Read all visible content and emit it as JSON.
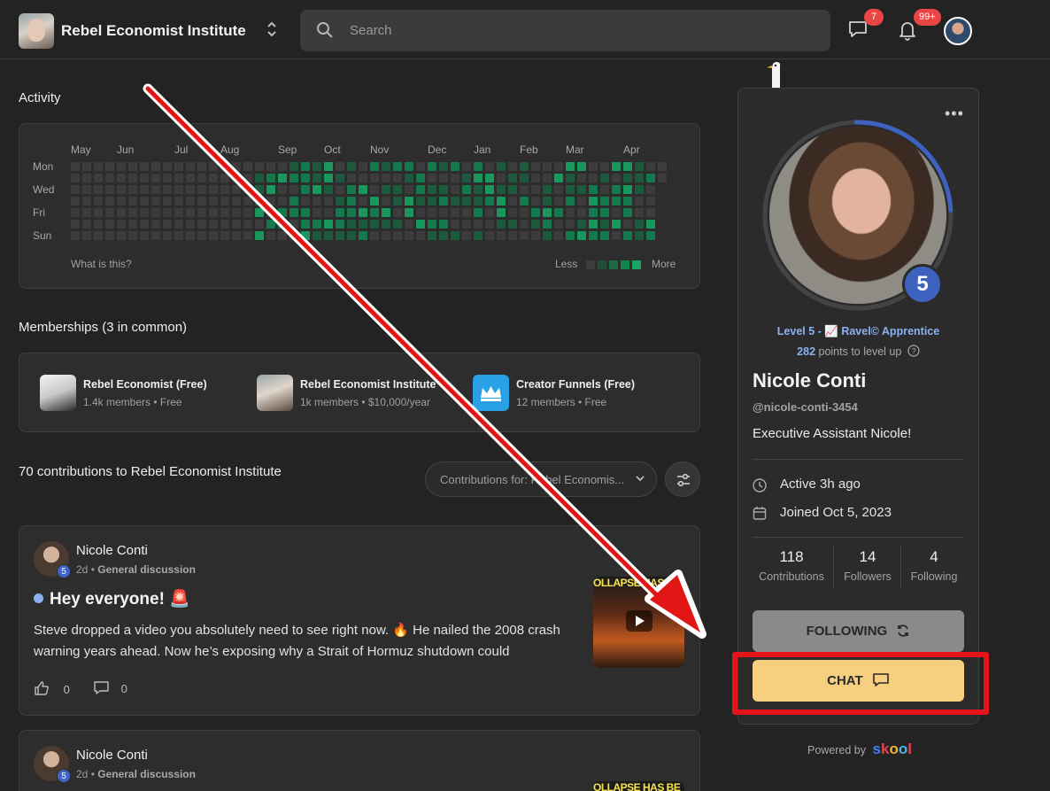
{
  "header": {
    "brand": "Rebel Economist Institute",
    "search_placeholder": "Search",
    "chat_badge": "7",
    "notif_badge": "99+"
  },
  "activity": {
    "title": "Activity",
    "months": [
      "May",
      "Jun",
      "Jul",
      "Aug",
      "Sep",
      "Oct",
      "Nov",
      "Dec",
      "Jan",
      "Feb",
      "Mar",
      "Apr"
    ],
    "days": [
      "Mon",
      "Wed",
      "Fri",
      "Sun"
    ],
    "what_is_this": "What is this?",
    "less": "Less",
    "more": "More"
  },
  "memberships": {
    "title": "Memberships (3 in common)",
    "items": [
      {
        "name": "Rebel Economist (Free)",
        "sub": "1.4k members • Free"
      },
      {
        "name": "Rebel Economist Institute",
        "sub": "1k members • $10,000/year"
      },
      {
        "name": "Creator Funnels (Free)",
        "sub": "12 members • Free"
      }
    ]
  },
  "contributions": {
    "title": "70 contributions to Rebel Economist Institute",
    "filter_label": "Contributions for: Rebel Economis..."
  },
  "posts": [
    {
      "author": "Nicole Conti",
      "level": "5",
      "time": "2d",
      "category": "General discussion",
      "title": "Hey everyone! 🚨",
      "body": "Steve dropped a video you absolutely need to see right now. 🔥 He nailed the 2008 crash warning years ahead. Now he’s exposing why a Strait of Hormuz shutdown could",
      "thumb_text": "OLLAPSE HAS BE",
      "likes": "0",
      "comments": "0"
    },
    {
      "author": "Nicole Conti",
      "level": "5",
      "time": "2d",
      "category": "General discussion",
      "thumb_text": "OLLAPSE HAS BE"
    }
  ],
  "profile": {
    "level_badge": "5",
    "level_text": "Level 5 - 📈 Ravel© Apprentice",
    "points": "282",
    "points_suffix": " points to level up",
    "name": "Nicole Conti",
    "handle": "@nicole-conti-3454",
    "bio": "Executive Assistant Nicole!",
    "active": "Active 3h ago",
    "joined": "Joined Oct 5, 2023",
    "stats": [
      {
        "value": "118",
        "label": "Contributions"
      },
      {
        "value": "14",
        "label": "Followers"
      },
      {
        "value": "4",
        "label": "Following"
      }
    ],
    "following_label": "FOLLOWING",
    "chat_label": "CHAT",
    "powered_by": "Powered by",
    "skool": "skool",
    "level_progress": 0.25
  },
  "colors": {
    "accent_blue": "#3e62c0",
    "chat_button": "#f6cf7f",
    "highlight_red": "#e4141a",
    "heat_levels": [
      "#3c3c3c",
      "#1d5a3d",
      "#147a4d",
      "#18985d"
    ]
  }
}
